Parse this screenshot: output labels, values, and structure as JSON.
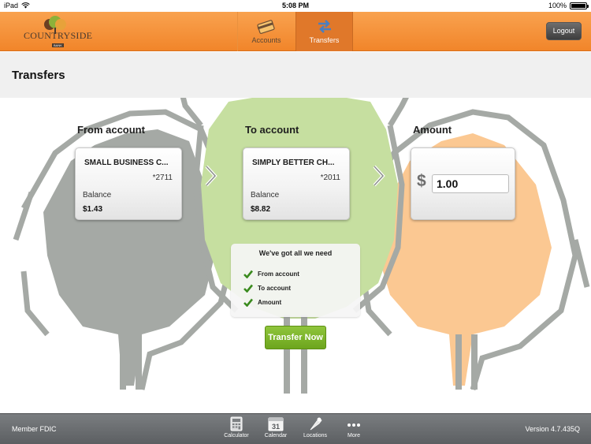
{
  "status_bar": {
    "device": "iPad",
    "time": "5:08 PM",
    "battery": "100%"
  },
  "header": {
    "logo_text": "COUNTRYSIDE",
    "logo_subtext": "BANK",
    "tabs": [
      {
        "label": "Accounts",
        "icon": "credit-card-icon",
        "active": false
      },
      {
        "label": "Transfers",
        "icon": "transfer-arrows-icon",
        "active": true
      }
    ],
    "logout_label": "Logout"
  },
  "page": {
    "title": "Transfers"
  },
  "transfer": {
    "from_label": "From account",
    "to_label": "To account",
    "amount_label": "Amount",
    "from_account": {
      "name": "SMALL BUSINESS C...",
      "number": "*2711",
      "balance_label": "Balance",
      "balance": "$1.43"
    },
    "to_account": {
      "name": "SIMPLY BETTER CH...",
      "number": "*2011",
      "balance_label": "Balance",
      "balance": "$8.82"
    },
    "currency_symbol": "$",
    "amount_value": "1.00",
    "checklist": {
      "title": "We've got all we need",
      "items": [
        "From account",
        "To account",
        "Amount"
      ]
    },
    "submit_label": "Transfer Now"
  },
  "footer": {
    "left_text": "Member FDIC",
    "tabs": [
      {
        "label": "Calculator",
        "icon": "calculator-icon"
      },
      {
        "label": "Calendar",
        "icon": "calendar-icon",
        "icon_text": "31"
      },
      {
        "label": "Locations",
        "icon": "map-pin-icon"
      },
      {
        "label": "More",
        "icon": "more-dots-icon"
      }
    ],
    "version": "Version 4.7.435Q"
  },
  "colors": {
    "header_orange": "#f1852a",
    "active_tab": "#e0782a",
    "tree_gray": "#a8aca8",
    "tree_green": "#c6dfa0",
    "tree_orange": "#fbc892",
    "button_green": "#7ab22a",
    "check_green": "#3a8a1e"
  }
}
